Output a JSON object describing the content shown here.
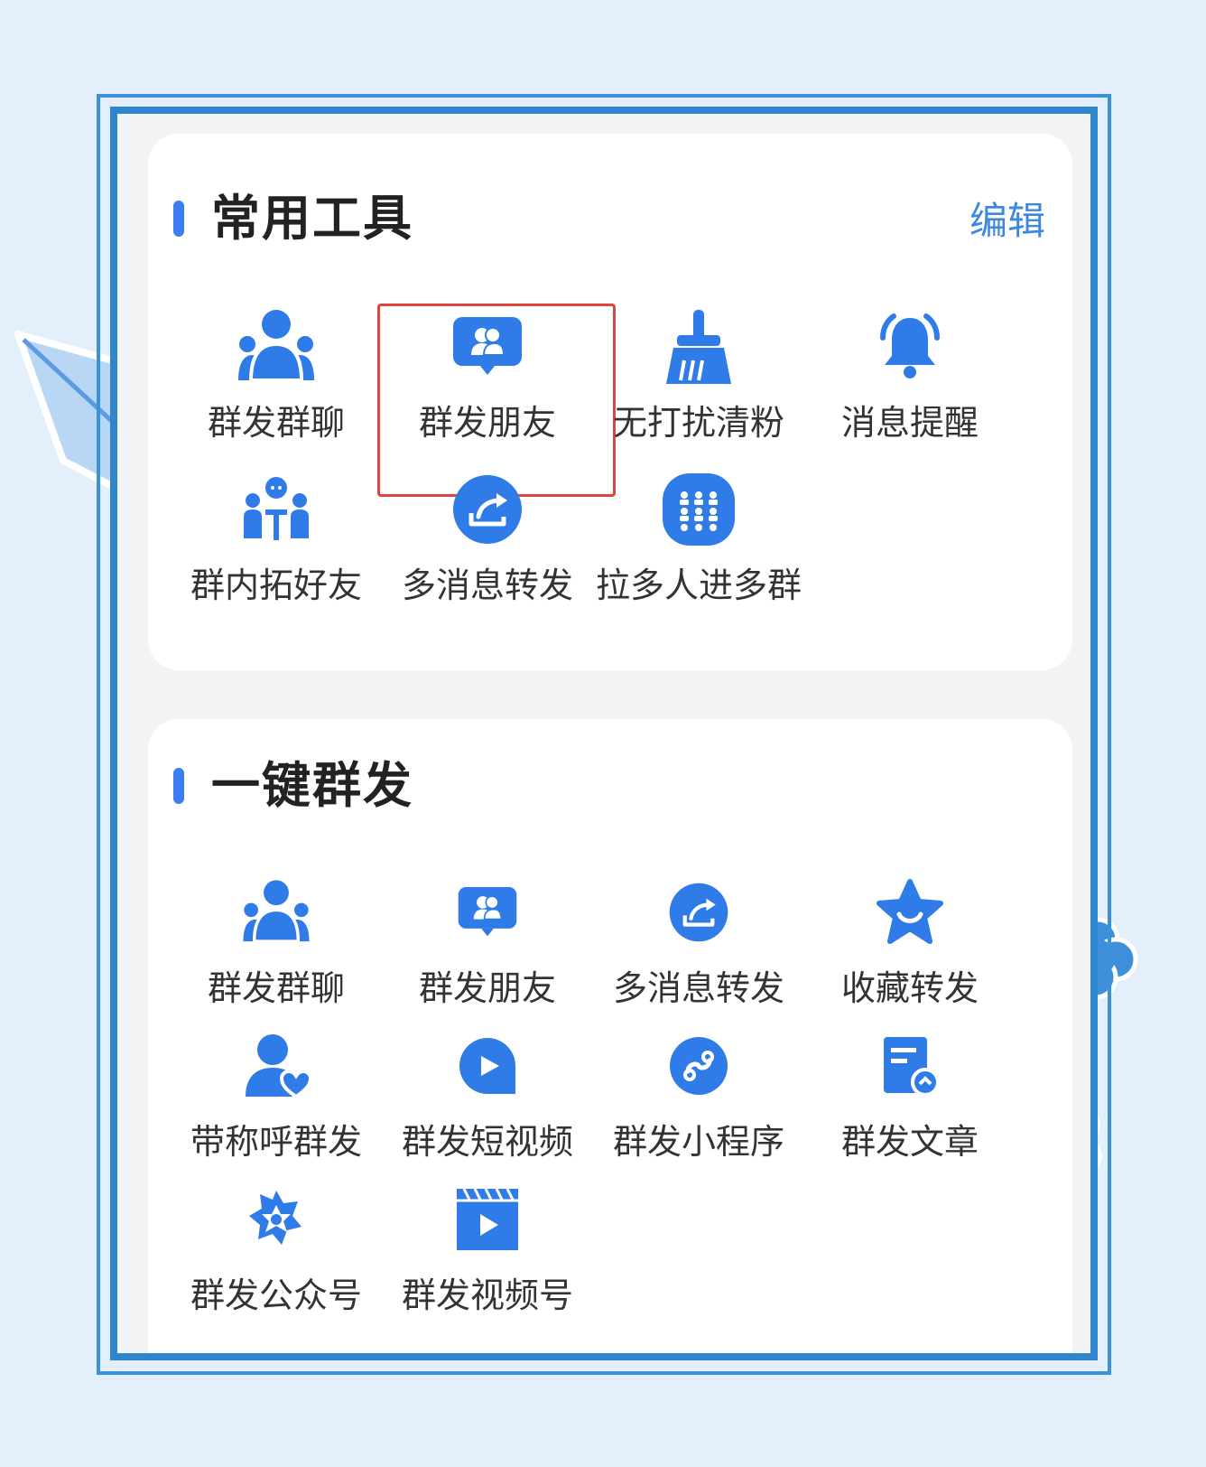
{
  "theme": {
    "accent": "#2f7ce8",
    "frame": "#2f86cf",
    "highlight": "#e0453d",
    "title": "#222222",
    "label": "#333333",
    "link": "#3e89e0"
  },
  "sections": [
    {
      "title": "常用工具",
      "action": "编辑",
      "items": [
        {
          "label": "群发群聊",
          "icon": "group-icon"
        },
        {
          "label": "群发朋友",
          "icon": "friends-chat-icon",
          "highlighted": true
        },
        {
          "label": "无打扰清粉",
          "icon": "broom-icon"
        },
        {
          "label": "消息提醒",
          "icon": "bell-icon"
        },
        {
          "label": "群内拓好友",
          "icon": "meeting-icon"
        },
        {
          "label": "多消息转发",
          "icon": "forward-icon"
        },
        {
          "label": "拉多人进多群",
          "icon": "crowd-icon"
        }
      ]
    },
    {
      "title": "一键群发",
      "items": [
        {
          "label": "群发群聊",
          "icon": "group-icon"
        },
        {
          "label": "群发朋友",
          "icon": "friends-chat-icon"
        },
        {
          "label": "多消息转发",
          "icon": "forward-icon"
        },
        {
          "label": "收藏转发",
          "icon": "star-icon"
        },
        {
          "label": "带称呼群发",
          "icon": "user-heart-icon"
        },
        {
          "label": "群发短视频",
          "icon": "play-bubble-icon"
        },
        {
          "label": "群发小程序",
          "icon": "mini-program-icon"
        },
        {
          "label": "群发文章",
          "icon": "article-icon"
        },
        {
          "label": "群发公众号",
          "icon": "official-account-icon"
        },
        {
          "label": "群发视频号",
          "icon": "clapper-icon"
        }
      ]
    }
  ]
}
